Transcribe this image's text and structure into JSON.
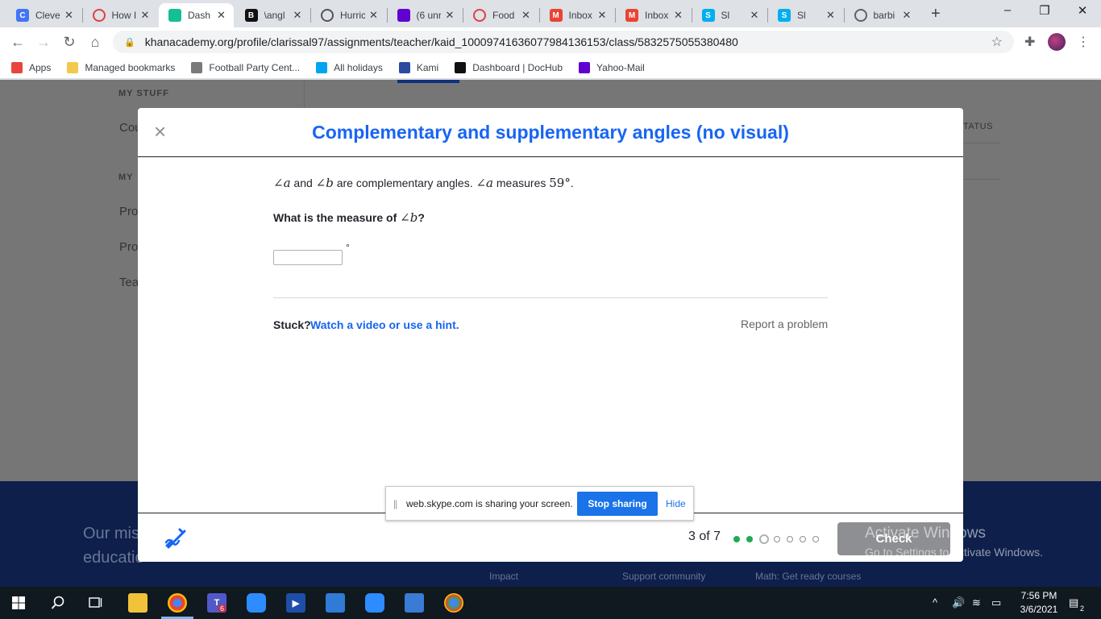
{
  "browser": {
    "tabs": [
      {
        "title": "Cleve",
        "icon": "clever-icon",
        "color": "#4274f6",
        "glyph": "C",
        "active": false
      },
      {
        "title": "How I",
        "icon": "circle-logo-icon",
        "color": "#e04040",
        "glyph": "",
        "active": false
      },
      {
        "title": "Dash",
        "icon": "khan-academy-icon",
        "color": "#14bf96",
        "glyph": "",
        "active": true
      },
      {
        "title": "\\angl",
        "icon": "brainly-icon",
        "color": "#111111",
        "glyph": "B",
        "active": false
      },
      {
        "title": "Hurric",
        "icon": "circle-logo-icon",
        "color": "#555555",
        "glyph": "",
        "active": false
      },
      {
        "title": "(6 unr",
        "icon": "mail-icon",
        "color": "#6001d2",
        "glyph": "",
        "active": false
      },
      {
        "title": "Food",
        "icon": "circle-logo-icon",
        "color": "#e04040",
        "glyph": "",
        "active": false
      },
      {
        "title": "Inbox",
        "icon": "gmail-icon",
        "color": "#ea4335",
        "glyph": "M",
        "active": false
      },
      {
        "title": "Inbox",
        "icon": "gmail-icon",
        "color": "#ea4335",
        "glyph": "M",
        "active": false
      },
      {
        "title": "Sl",
        "icon": "skype-icon",
        "color": "#00aff0",
        "glyph": "S",
        "active": false
      },
      {
        "title": "Sl",
        "icon": "skype-icon",
        "color": "#00aff0",
        "glyph": "S",
        "active": false
      },
      {
        "title": "barbi",
        "icon": "globe-icon",
        "color": "#5f6368",
        "glyph": "",
        "active": false
      }
    ],
    "url": "khanacademy.org/profile/clarissal97/assignments/teacher/kaid_1000974163607798413615​3/class/5832575055380480",
    "bookmarks": [
      {
        "label": "Apps",
        "icon": "apps-grid-icon",
        "color": "#e8453c"
      },
      {
        "label": "Managed bookmarks",
        "icon": "folder-icon",
        "color": "#f2c94c"
      },
      {
        "label": "Football Party Cent...",
        "icon": "site-icon",
        "color": "#7a7a7a"
      },
      {
        "label": "All holidays",
        "icon": "windows-icon",
        "color": "#00a4ef"
      },
      {
        "label": "Kami",
        "icon": "kami-icon",
        "color": "#2a4ba0"
      },
      {
        "label": "Dashboard | DocHub",
        "icon": "dochub-icon",
        "color": "#111111"
      },
      {
        "label": "Yahoo-Mail",
        "icon": "mail-icon",
        "color": "#6001d2"
      }
    ]
  },
  "background": {
    "sidebar_heading_1": "MY STUFF",
    "sidebar_item_1": "Cou",
    "sidebar_heading_2": "MY",
    "sidebar_items": [
      "Pro",
      "Pro",
      "Tea"
    ],
    "status_header": "TATUS",
    "footer_mission_1": "Our mis",
    "footer_mission_2": "educatio",
    "footer_links": [
      "Impact",
      "Support community",
      "Math: Get ready courses"
    ]
  },
  "modal": {
    "title": "Complementary and supplementary angles (no visual)",
    "close": "×",
    "question": {
      "angle_a": "∠a",
      "and": "and",
      "angle_b": "∠b",
      "text1": "are complementary angles.",
      "angle_a2": "∠a",
      "measures": "measures",
      "value": "59°",
      "period": "."
    },
    "prompt_prefix": "What is the measure of",
    "prompt_angle": "∠b",
    "prompt_suffix": "?",
    "answer_value": "",
    "degree_symbol": "°",
    "stuck": "Stuck?",
    "hint_link": "Watch a video or use a hint.",
    "report_link": "Report a problem",
    "progress": "3 of 7",
    "progress_current": 3,
    "progress_total": 7,
    "check_label": "Check",
    "colors": {
      "accent": "#1865f2",
      "done": "#1fab54"
    }
  },
  "skype_bar": {
    "message": "web.skype.com is sharing your screen.",
    "stop_label": "Stop sharing",
    "hide_label": "Hide"
  },
  "watermark": {
    "line1": "Activate Windows",
    "line2": "Go to Settings to activate Windows."
  },
  "taskbar": {
    "time": "7:56 PM",
    "date": "3/6/2021",
    "notifications": "2",
    "teams_badge": "6"
  }
}
